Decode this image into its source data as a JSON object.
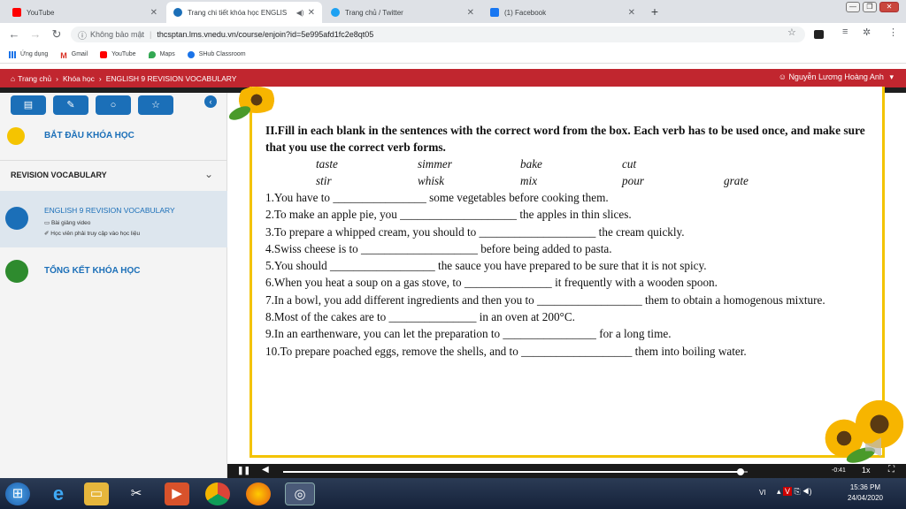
{
  "browser": {
    "tabs": [
      {
        "title": "YouTube",
        "icon": "youtube-icon",
        "color": "#ff0000"
      },
      {
        "title": "Trang chi tiết khóa học ENGLIS",
        "icon": "site-icon",
        "color": "#1b6fb8"
      },
      {
        "title": "Trang chủ / Twitter",
        "icon": "twitter-icon",
        "color": "#1da1f2"
      },
      {
        "title": "(1) Facebook",
        "icon": "facebook-icon",
        "color": "#1877f2"
      }
    ],
    "new_tab": "+",
    "security": "Không bảo mật",
    "url": "thcsptan.lms.vnedu.vn/course/enjoin?id=5e995afd1fc2e8qt05",
    "bookmarks": [
      "Ứng dụng",
      "Gmail",
      "YouTube",
      "Maps",
      "SHub Classroom"
    ]
  },
  "site": {
    "breadcrumb": [
      "Trang chủ",
      "Khóa học",
      "ENGLISH 9 REVISION VOCABULARY"
    ],
    "user": "Nguyễn Lương Hoàng Anh"
  },
  "sidebar": {
    "start": "BẮT ĐẦU KHÓA HỌC",
    "section": "REVISION VOCABULARY",
    "lesson_title": "ENGLISH 9 REVISION VOCABULARY",
    "lesson_type": "Bài giảng video",
    "lesson_note": "Học viên phải truy cập vào học liệu",
    "summary": "TỔNG KẾT KHÓA HỌC"
  },
  "exercise": {
    "heading": "II.Fill in each blank in the sentences with the correct word from the box. Each verb has to be used once, and make sure that you use the correct verb forms.",
    "words_row1": [
      "taste",
      "simmer",
      "bake",
      "cut"
    ],
    "words_row2": [
      "stir",
      "whisk",
      "mix",
      "pour",
      "grate"
    ],
    "sentences": [
      "1.You have to ________________ some vegetables before cooking them.",
      "2.To make an apple pie, you ____________________ the apples in thin slices.",
      "3.To prepare a whipped cream, you should to ____________________ the cream quickly.",
      "4.Swiss cheese is to ____________________ before being added to pasta.",
      "5.You should __________________ the sauce you have prepared to be sure that it is not spicy.",
      "6.When you heat a soup on a gas stove, to _______________ it frequently with a wooden spoon.",
      "7.In a bowl, you add different ingredients and then you to __________________ them to obtain a homogenous mixture.",
      "8.Most of the cakes are to _______________ in an oven at 200°C.",
      "9.In an earthenware, you can let the preparation to ________________ for a long time.",
      "10.To prepare poached eggs, remove the shells, and   to ___________________ them into boiling water."
    ]
  },
  "video": {
    "time": "-0:41",
    "speed": "1x",
    "progress": 0.985
  },
  "taskbar": {
    "lang": "VI",
    "time": "15:36 PM",
    "date": "24/04/2020"
  }
}
